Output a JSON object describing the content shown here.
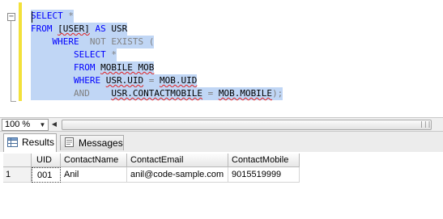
{
  "editor": {
    "collapse_symbol": "−",
    "lines": [
      [
        {
          "t": "SELECT",
          "c": "kw"
        },
        {
          "t": " *",
          "c": "gray"
        }
      ],
      [
        {
          "t": "FROM ",
          "c": "kw"
        },
        {
          "t": "[USER]",
          "c": "txt",
          "squig": true
        },
        {
          "t": " ",
          "c": "txt"
        },
        {
          "t": "AS",
          "c": "kw"
        },
        {
          "t": " USR",
          "c": "txt"
        }
      ],
      [
        {
          "t": "    WHERE",
          "c": "kw"
        },
        {
          "t": "  NOT EXISTS (",
          "c": "gray"
        }
      ],
      [
        {
          "t": "        SELECT",
          "c": "kw"
        },
        {
          "t": " *",
          "c": "gray"
        }
      ],
      [
        {
          "t": "        FROM ",
          "c": "kw"
        },
        {
          "t": "MOBILE MOB",
          "c": "txt",
          "squig": true
        }
      ],
      [
        {
          "t": "        WHERE ",
          "c": "kw"
        },
        {
          "t": "USR.UID",
          "c": "txt",
          "squig": true
        },
        {
          "t": " = ",
          "c": "gray"
        },
        {
          "t": "MOB.UID",
          "c": "txt",
          "squig": true
        }
      ],
      [
        {
          "t": "        AND",
          "c": "gray"
        },
        {
          "t": "    ",
          "c": "txt"
        },
        {
          "t": "USR.CONTACTMOBILE",
          "c": "txt",
          "squig": true
        },
        {
          "t": " = ",
          "c": "gray"
        },
        {
          "t": "MOB.MOBILE",
          "c": "txt",
          "squig": true
        },
        {
          "t": ");",
          "c": "gray"
        }
      ]
    ]
  },
  "zoom": {
    "value": "100 %"
  },
  "tabs": [
    {
      "label": "Results",
      "active": true
    },
    {
      "label": "Messages",
      "active": false
    }
  ],
  "grid": {
    "columns": [
      "UID",
      "ContactName",
      "ContactEmail",
      "ContactMobile"
    ],
    "rows": [
      {
        "num": "1",
        "cells": [
          "001",
          "Anil",
          "anil@code-sample.com",
          "9015519999"
        ]
      }
    ]
  },
  "colors": {
    "selection": "#c0d6f5",
    "keyword": "#0000ff",
    "operator": "#808080",
    "change_bar": "#f3e13a"
  }
}
